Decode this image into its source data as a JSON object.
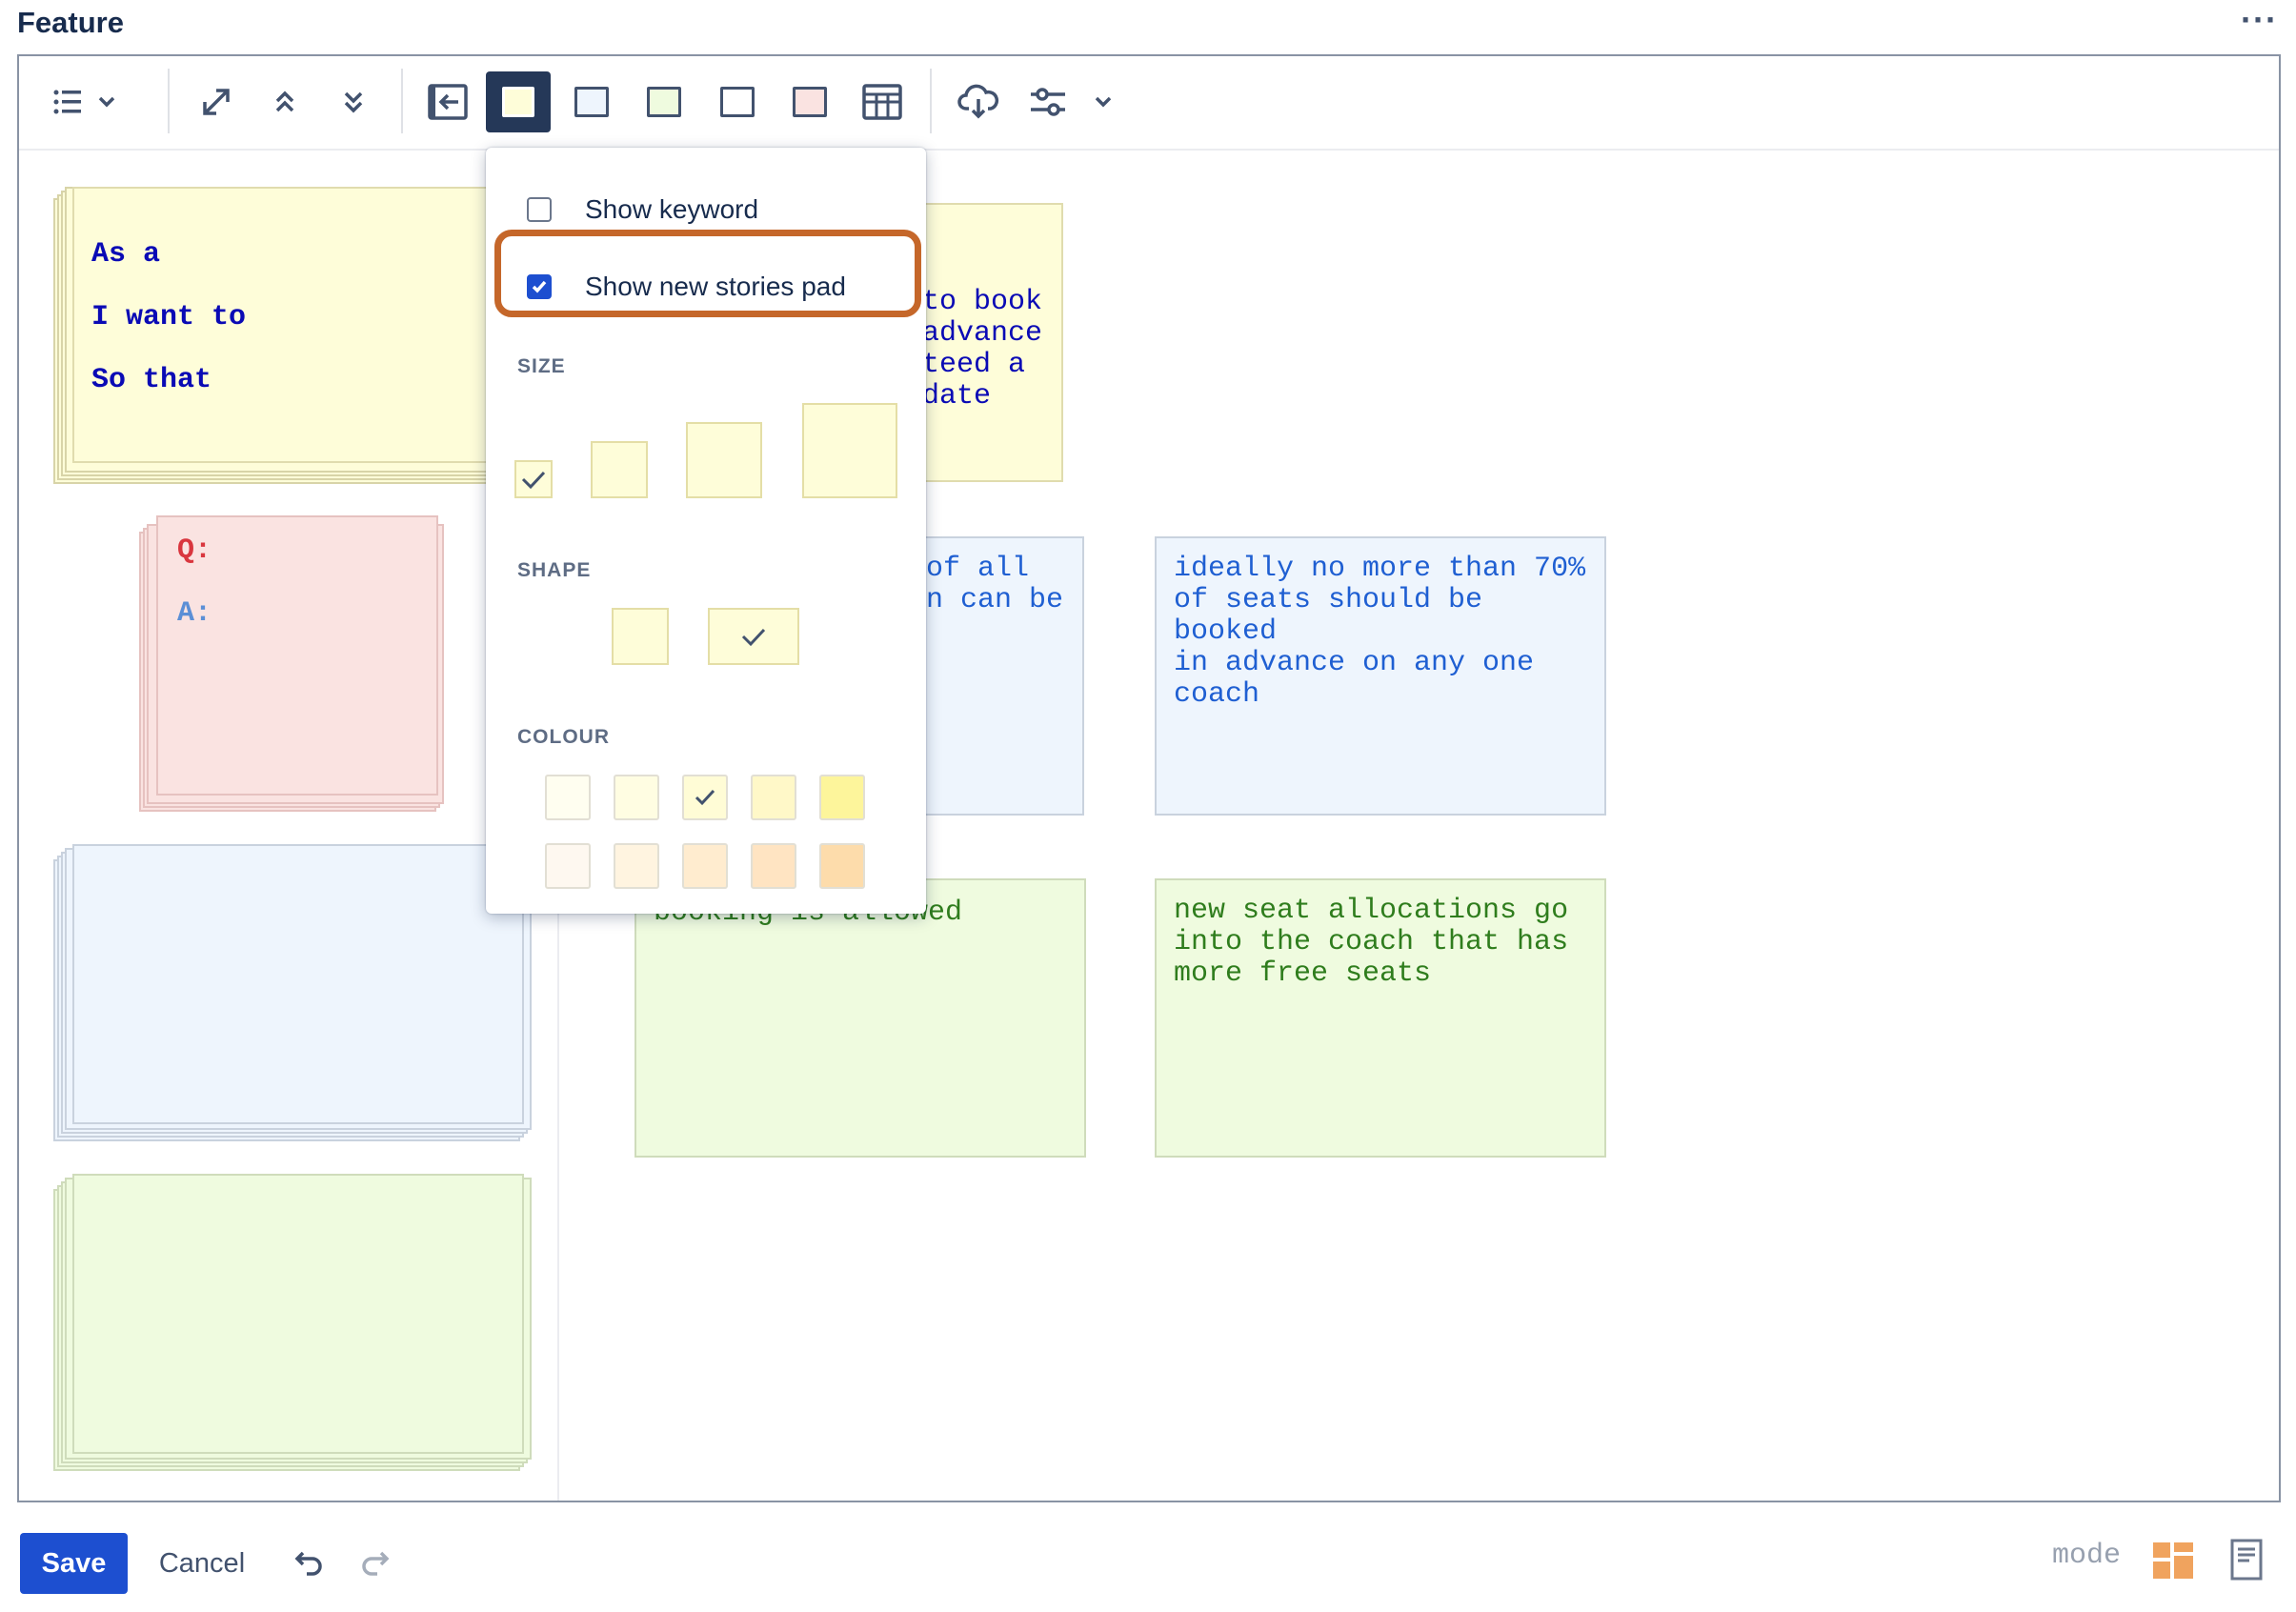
{
  "header": {
    "title": "Feature",
    "more_label": "···"
  },
  "toolbar": {
    "buttons": [
      "list-icon",
      "chevron-down-icon",
      "expand-icon",
      "collapse-up-icon",
      "expand-down-icon",
      "sidebar-toggle-icon",
      "yellow-card-icon",
      "blue-card-icon",
      "green-card-icon",
      "white-card-icon",
      "red-card-icon",
      "table-icon",
      "cloud-download-icon",
      "sliders-icon",
      "chevron-down-icon"
    ]
  },
  "pads": {
    "story": {
      "lines": [
        "As a",
        "I want to",
        "So that"
      ]
    },
    "question": {
      "q": "Q:",
      "a": "A:"
    }
  },
  "cards": {
    "story_card": "to book\nadvance\nteed a\ndate",
    "rule_card": "of all\nn can be\n",
    "rule_card_2": "ideally no more than 70%\nof seats should be booked\nin advance on any one\ncoach",
    "example_card": "booking is allowed",
    "example_card_2": "new seat allocations go\ninto the coach that has\nmore free seats"
  },
  "menu": {
    "show_keyword": "Show keyword",
    "show_keyword_checked": false,
    "show_new_stories_pad": "Show new stories pad",
    "show_new_stories_pad_checked": true,
    "size_label": "SIZE",
    "shape_label": "SHAPE",
    "colour_label": "COLOUR",
    "size_selected_index": 0,
    "shape_selected_index": 1,
    "colour_selected_index": 2,
    "colours_row1": [
      "#fffef0",
      "#fffde2",
      "#fffcd6",
      "#fff8c8",
      "#fdf59b"
    ],
    "colours_row2": [
      "#fef8f0",
      "#fff4e0",
      "#ffeccf",
      "#ffe4c2",
      "#fddcab"
    ]
  },
  "footer": {
    "save_label": "Save",
    "cancel_label": "Cancel",
    "mode_label": "mode"
  },
  "colors": {
    "accent": "#1d4fd0",
    "yellow_pad": "#fefdd9",
    "red_pad": "#fae3e1",
    "blue_pad": "#eef5fd",
    "green_pad": "#effbdf",
    "highlight": "#c5672a"
  }
}
